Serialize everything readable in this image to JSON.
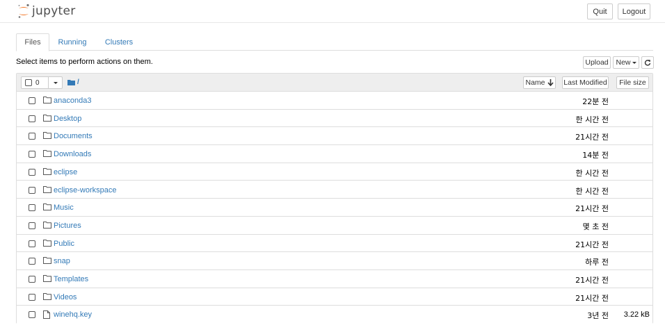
{
  "header": {
    "logo_text": "jupyter",
    "quit_label": "Quit",
    "logout_label": "Logout"
  },
  "tabs": [
    {
      "label": "Files",
      "active": true
    },
    {
      "label": "Running",
      "active": false
    },
    {
      "label": "Clusters",
      "active": false
    }
  ],
  "toolbar": {
    "select_message": "Select items to perform actions on them.",
    "upload_label": "Upload",
    "new_label": "New",
    "refresh_icon": "refresh-icon"
  },
  "list_header": {
    "selected_count": "0",
    "path": "/",
    "sort_name_label": "Name",
    "sort_modified_label": "Last Modified",
    "sort_size_label": "File size"
  },
  "files": [
    {
      "name": "anaconda3",
      "type": "folder",
      "modified": "22분 전",
      "size": ""
    },
    {
      "name": "Desktop",
      "type": "folder",
      "modified": "한 시간 전",
      "size": ""
    },
    {
      "name": "Documents",
      "type": "folder",
      "modified": "21시간 전",
      "size": ""
    },
    {
      "name": "Downloads",
      "type": "folder",
      "modified": "14분 전",
      "size": ""
    },
    {
      "name": "eclipse",
      "type": "folder",
      "modified": "한 시간 전",
      "size": ""
    },
    {
      "name": "eclipse-workspace",
      "type": "folder",
      "modified": "한 시간 전",
      "size": ""
    },
    {
      "name": "Music",
      "type": "folder",
      "modified": "21시간 전",
      "size": ""
    },
    {
      "name": "Pictures",
      "type": "folder",
      "modified": "몇 초 전",
      "size": ""
    },
    {
      "name": "Public",
      "type": "folder",
      "modified": "21시간 전",
      "size": ""
    },
    {
      "name": "snap",
      "type": "folder",
      "modified": "하루 전",
      "size": ""
    },
    {
      "name": "Templates",
      "type": "folder",
      "modified": "21시간 전",
      "size": ""
    },
    {
      "name": "Videos",
      "type": "folder",
      "modified": "21시간 전",
      "size": ""
    },
    {
      "name": "winehq.key",
      "type": "file",
      "modified": "3년 전",
      "size": "3.22 kB"
    }
  ],
  "colors": {
    "link": "#337ab7",
    "logo_orange": "#f37726",
    "header_bg": "#eeeeee"
  }
}
